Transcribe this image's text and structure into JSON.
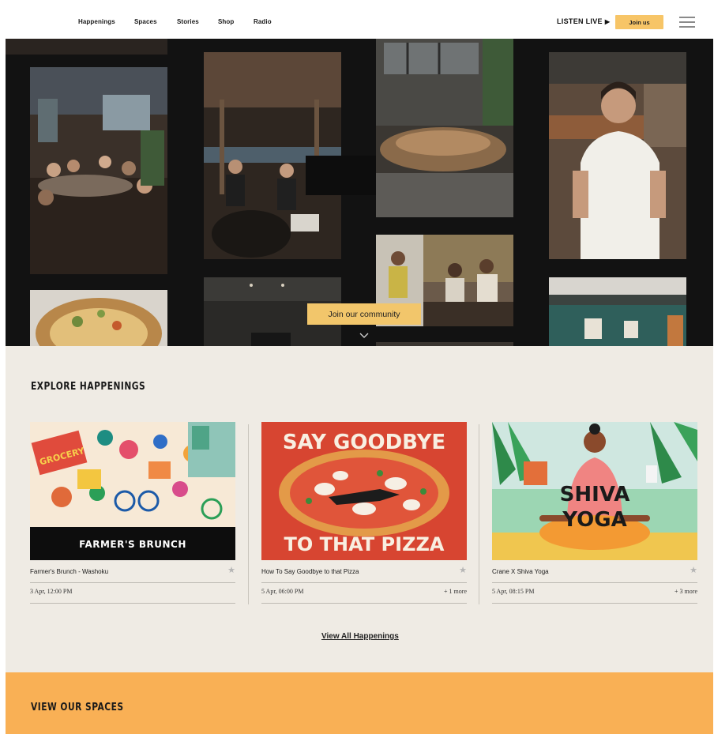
{
  "nav": {
    "links": [
      "Happenings",
      "Spaces",
      "Stories",
      "Shop",
      "Radio"
    ],
    "listen_live": "LISTEN LIVE",
    "join_label": "Join us"
  },
  "hero": {
    "cta_label": "Join our community"
  },
  "happenings": {
    "title": "EXPLORE HAPPENINGS",
    "cards": [
      {
        "title": "Farmer's Brunch - Washoku",
        "date": "3 Apr, 12:00 PM",
        "more": "",
        "banner": "FARMER'S BRUNCH",
        "art_text": "GROCERY"
      },
      {
        "title": "How To Say Goodbye to that Pizza",
        "date": "5 Apr, 06:00 PM",
        "more": "+ 1 more",
        "banner_top": "SAY GOODBYE",
        "banner_bottom": "TO THAT PIZZA"
      },
      {
        "title": "Crane X Shiva Yoga",
        "date": "5 Apr, 08:15 PM",
        "more": "+ 3 more",
        "banner_top": "SHIVA",
        "banner_bottom": "YOGA"
      }
    ],
    "view_all": "View All Happenings"
  },
  "spaces": {
    "title": "VIEW OUR SPACES"
  },
  "colors": {
    "accent": "#f7c567",
    "spaces_band": "#f9b055",
    "page_bg": "#efebe4",
    "hero_bg": "#121212"
  }
}
